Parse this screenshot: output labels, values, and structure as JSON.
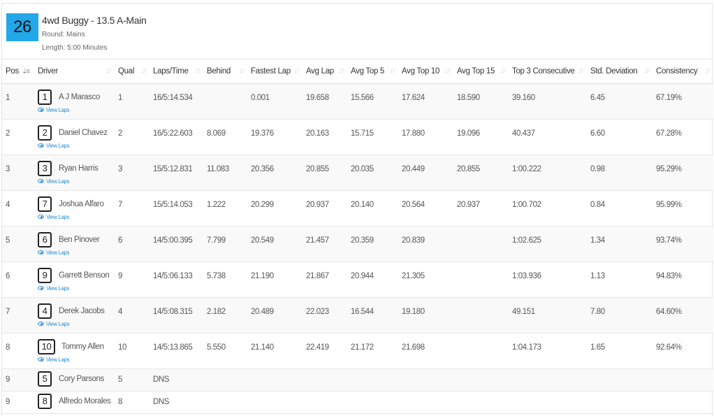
{
  "race": {
    "number": "26",
    "title": "4wd Buggy - 13.5 A-Main",
    "round": "Round: Mains",
    "length": "Length: 5:00 Minutes"
  },
  "view_laps_label": "View Laps",
  "columns": [
    "Pos",
    "Driver",
    "Qual",
    "Laps/Time",
    "Behind",
    "Fastest Lap",
    "Avg Lap",
    "Avg Top 5",
    "Avg Top 10",
    "Avg Top 15",
    "Top 3 Consecutive",
    "Std. Deviation",
    "Consistency"
  ],
  "rows": [
    {
      "pos": "1",
      "car": "1",
      "driver": "A J Marasco",
      "qual": "1",
      "laps": "16/5:14.534",
      "behind": "",
      "fastest": "0.001",
      "avg": "19.658",
      "top5": "15.566",
      "top10": "17.624",
      "top15": "18.590",
      "top3c": "39.160",
      "std": "6.45",
      "consistency": "67.19%"
    },
    {
      "pos": "2",
      "car": "2",
      "driver": "Daniel Chavez",
      "qual": "2",
      "laps": "16/5:22.603",
      "behind": "8.069",
      "fastest": "19.376",
      "avg": "20.163",
      "top5": "15.715",
      "top10": "17.880",
      "top15": "19.096",
      "top3c": "40.437",
      "std": "6.60",
      "consistency": "67.28%"
    },
    {
      "pos": "3",
      "car": "3",
      "driver": "Ryan Harris",
      "qual": "3",
      "laps": "15/5:12.831",
      "behind": "11.083",
      "fastest": "20.356",
      "avg": "20.855",
      "top5": "20.035",
      "top10": "20.449",
      "top15": "20.855",
      "top3c": "1:00.222",
      "std": "0.98",
      "consistency": "95.29%"
    },
    {
      "pos": "4",
      "car": "7",
      "driver": "Joshua Alfaro",
      "qual": "7",
      "laps": "15/5:14.053",
      "behind": "1.222",
      "fastest": "20.299",
      "avg": "20.937",
      "top5": "20.140",
      "top10": "20.564",
      "top15": "20.937",
      "top3c": "1:00.702",
      "std": "0.84",
      "consistency": "95.99%"
    },
    {
      "pos": "5",
      "car": "6",
      "driver": "Ben Pinover",
      "qual": "6",
      "laps": "14/5:00.395",
      "behind": "7.799",
      "fastest": "20.549",
      "avg": "21.457",
      "top5": "20.359",
      "top10": "20.839",
      "top15": "",
      "top3c": "1:02.625",
      "std": "1.34",
      "consistency": "93.74%"
    },
    {
      "pos": "6",
      "car": "9",
      "driver": "Garrett Benson",
      "qual": "9",
      "laps": "14/5:06.133",
      "behind": "5.738",
      "fastest": "21.190",
      "avg": "21.867",
      "top5": "20.944",
      "top10": "21.305",
      "top15": "",
      "top3c": "1:03.936",
      "std": "1.13",
      "consistency": "94.83%"
    },
    {
      "pos": "7",
      "car": "4",
      "driver": "Derek Jacobs",
      "qual": "4",
      "laps": "14/5:08.315",
      "behind": "2.182",
      "fastest": "20.489",
      "avg": "22.023",
      "top5": "16.544",
      "top10": "19.180",
      "top15": "",
      "top3c": "49.151",
      "std": "7.80",
      "consistency": "64.60%"
    },
    {
      "pos": "8",
      "car": "10",
      "driver": "Tommy Allen",
      "qual": "10",
      "laps": "14/5:13.865",
      "behind": "5.550",
      "fastest": "21.140",
      "avg": "22.419",
      "top5": "21.172",
      "top10": "21.698",
      "top15": "",
      "top3c": "1:04.173",
      "std": "1.65",
      "consistency": "92.64%"
    },
    {
      "pos": "9",
      "car": "5",
      "driver": "Cory Parsons",
      "qual": "5",
      "laps": "DNS",
      "behind": "",
      "fastest": "",
      "avg": "",
      "top5": "",
      "top10": "",
      "top15": "",
      "top3c": "",
      "std": "",
      "consistency": ""
    },
    {
      "pos": "9",
      "car": "8",
      "driver": "Alfredo Morales",
      "qual": "8",
      "laps": "DNS",
      "behind": "",
      "fastest": "",
      "avg": "",
      "top5": "",
      "top10": "",
      "top15": "",
      "top3c": "",
      "std": "",
      "consistency": ""
    }
  ],
  "colors": {
    "race_badge": "#22a7e8",
    "view_laps_link": "#2b8fd6"
  }
}
